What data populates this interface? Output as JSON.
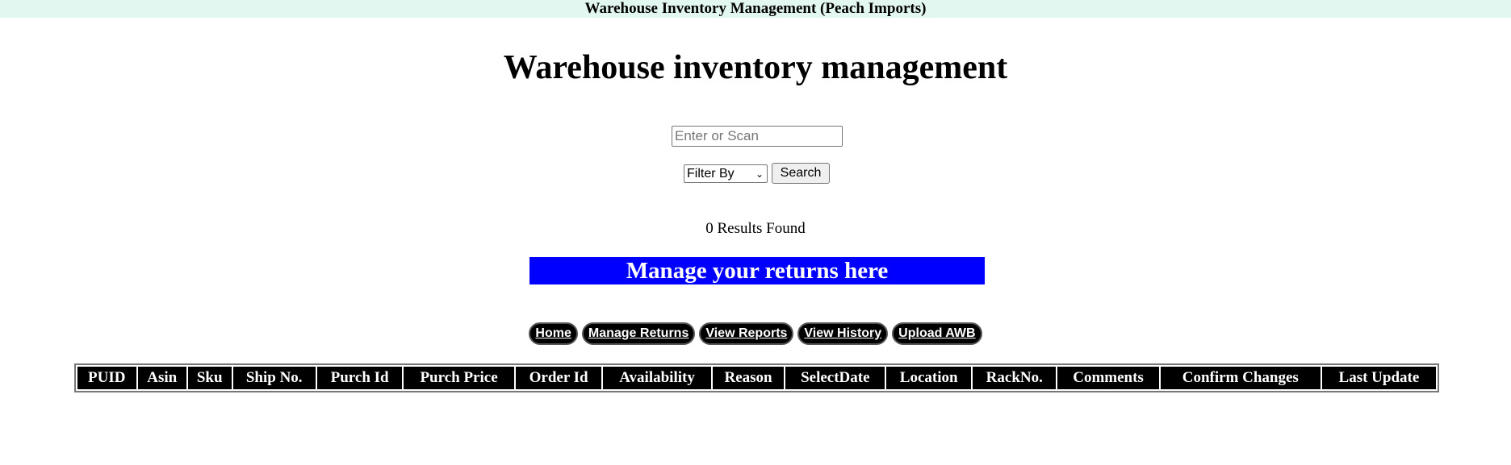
{
  "app": {
    "title": "Warehouse Inventory Management (Peach Imports)"
  },
  "main": {
    "heading": "Warehouse inventory management",
    "search": {
      "placeholder": "Enter or Scan",
      "value": ""
    },
    "filter": {
      "selected": "Filter By",
      "icon": "chevron-down-icon"
    },
    "search_button_label": "Search",
    "results_text": "0 Results Found",
    "returns_banner": "Manage your returns here",
    "nav": [
      {
        "label": "Home"
      },
      {
        "label": "Manage Returns"
      },
      {
        "label": "View Reports"
      },
      {
        "label": "View History"
      },
      {
        "label": "Upload AWB"
      }
    ],
    "table": {
      "columns": [
        "PUID",
        "Asin",
        "Sku",
        "Ship No.",
        "Purch Id",
        "Purch Price",
        "Order Id",
        "Availability",
        "Reason",
        "SelectDate",
        "Location",
        "RackNo.",
        "Comments",
        "Confirm Changes",
        "Last Update"
      ],
      "rows": []
    }
  },
  "colors": {
    "topbar_bg": "#e3f7f1",
    "banner_bg": "#0000ff",
    "nav_bg": "#000000",
    "table_header_bg": "#000000"
  }
}
